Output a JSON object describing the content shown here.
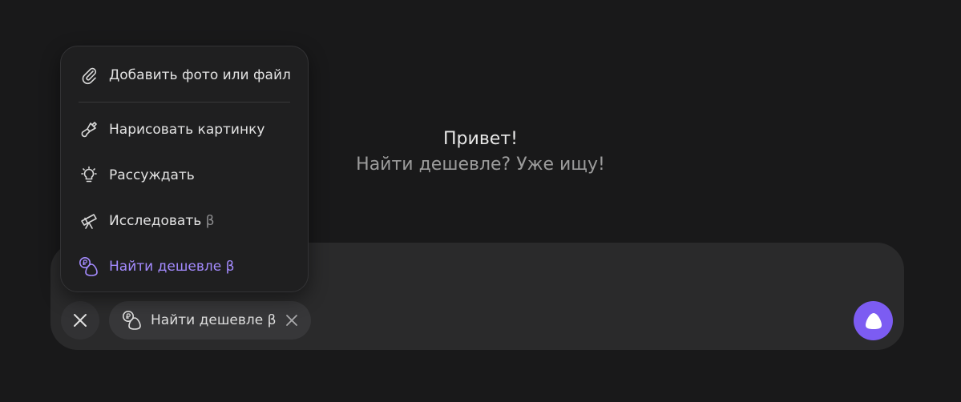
{
  "greeting": {
    "title": "Привет!",
    "subtitle": "Найти дешевле? Уже ищу!"
  },
  "menu": {
    "items": [
      {
        "label": "Добавить фото или файл",
        "beta": "",
        "icon": "paperclip-icon"
      },
      {
        "label": "Нарисовать картинку",
        "beta": "",
        "icon": "brush-icon"
      },
      {
        "label": "Рассуждать",
        "beta": "",
        "icon": "lightbulb-icon"
      },
      {
        "label": "Исследовать",
        "beta": "β",
        "icon": "telescope-icon"
      },
      {
        "label": "Найти дешевле",
        "beta": "β",
        "icon": "price-tag-icon"
      }
    ]
  },
  "composer": {
    "chip_label": "Найти дешевле β"
  },
  "colors": {
    "background": "#19191a",
    "accent": "#7c5cf2",
    "active_text": "#a48bff"
  }
}
